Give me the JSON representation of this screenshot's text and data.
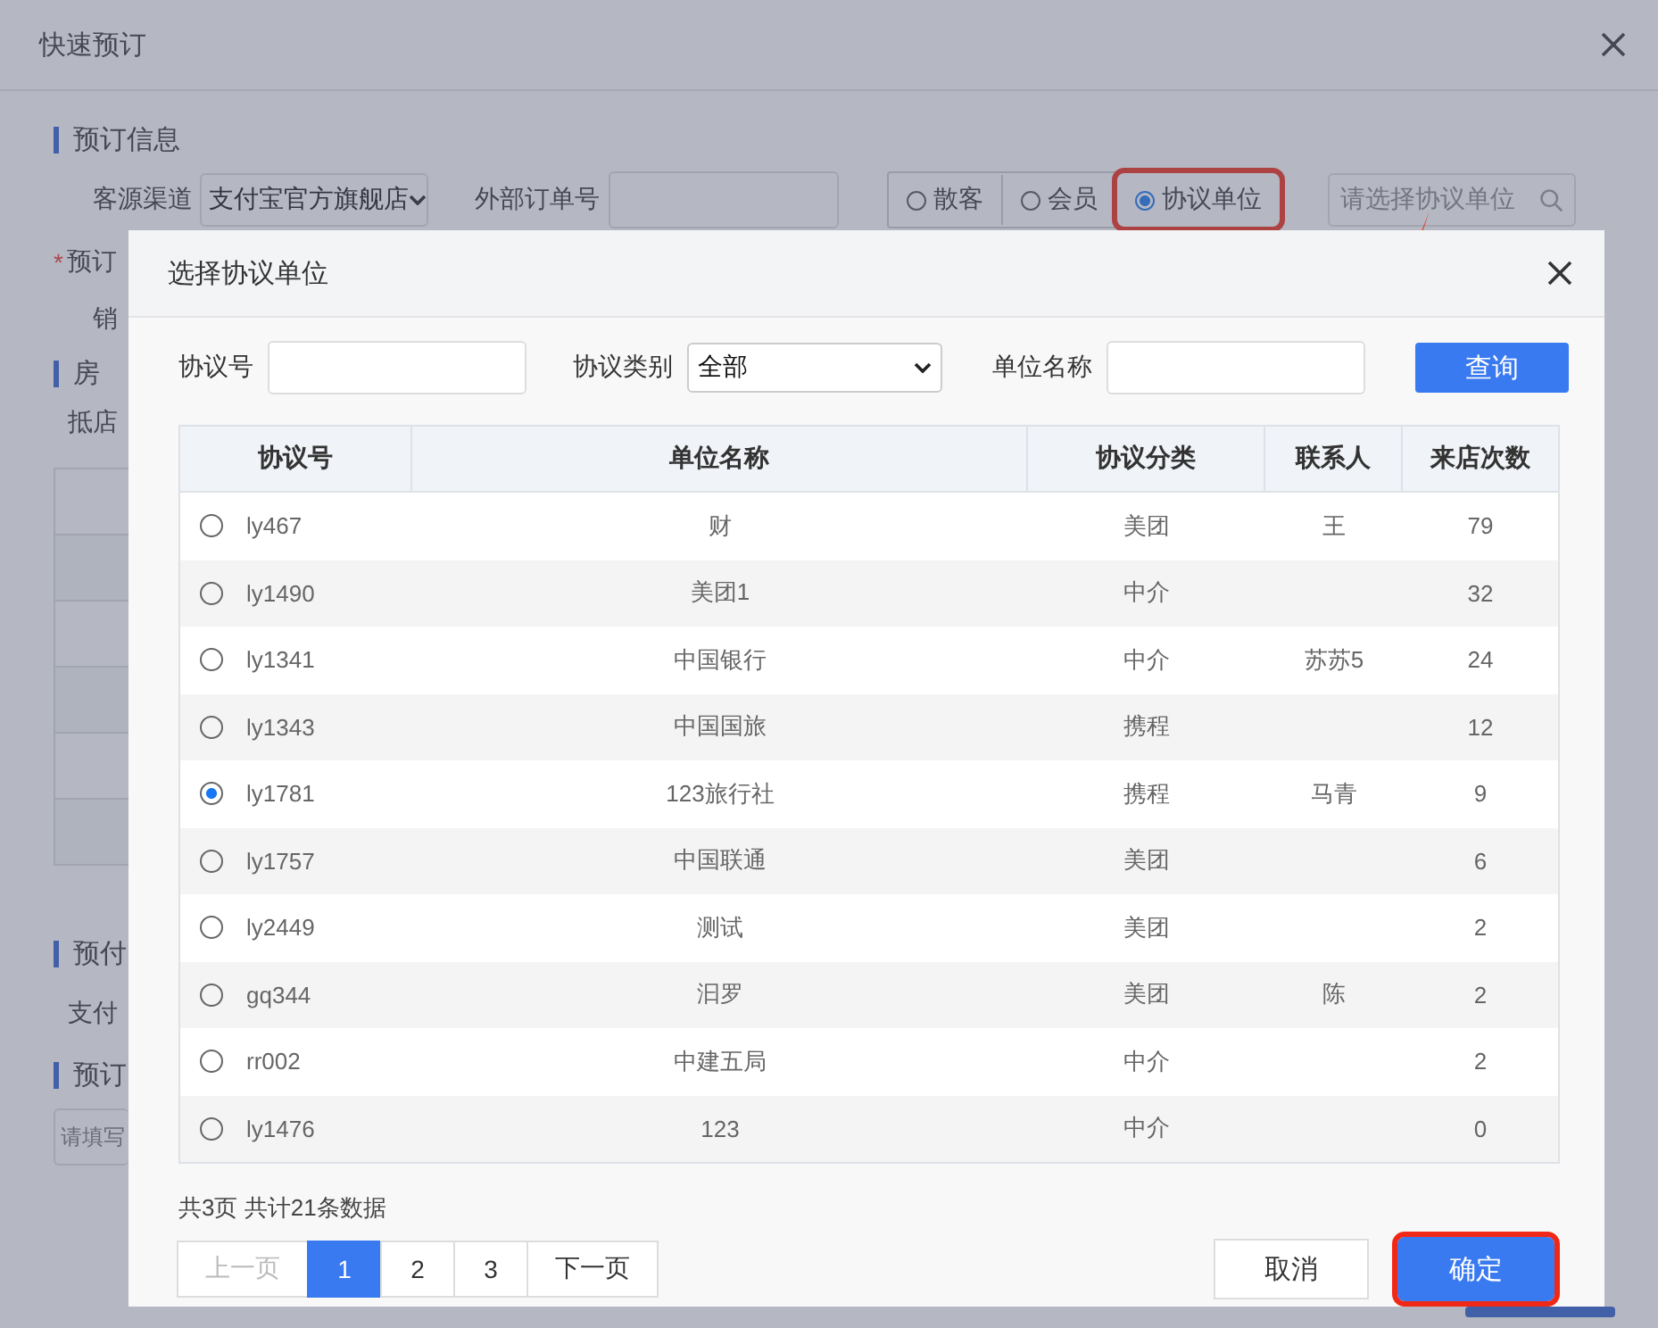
{
  "background_dialog": {
    "title": "快速预订",
    "section_1": {
      "title": "预订信息",
      "channel_label": "客源渠道",
      "channel_value": "支付宝官方旗舰店",
      "external_label": "外部订单号",
      "guest_types": [
        {
          "label": "散客",
          "selected": false,
          "highlighted": false
        },
        {
          "label": "会员",
          "selected": false,
          "highlighted": false
        },
        {
          "label": "协议单位",
          "selected": true,
          "highlighted": true
        }
      ],
      "unit_placeholder": "请选择协议单位",
      "booker_required": "*",
      "booker_label": "预订",
      "sales_label": "销"
    },
    "section_2": {
      "title": "房",
      "arrival_label": "抵店"
    },
    "section_3": {
      "title": "预付",
      "payment_label": "支付"
    },
    "section_4": {
      "title": "预订",
      "remark_placeholder": "请填写"
    }
  },
  "modal": {
    "title": "选择协议单位",
    "filters": {
      "code_label": "协议号",
      "type_label": "协议类别",
      "type_value": "全部",
      "name_label": "单位名称",
      "search_button": "查询"
    },
    "table": {
      "columns": [
        "协议号",
        "单位名称",
        "协议分类",
        "联系人",
        "来店次数"
      ],
      "rows": [
        {
          "selected": false,
          "code": "ly467",
          "name": "财",
          "category": "美团",
          "contact": "王",
          "visits": "79"
        },
        {
          "selected": false,
          "code": "ly1490",
          "name": "美团1",
          "category": "中介",
          "visits": "32"
        },
        {
          "selected": false,
          "code": "ly1341",
          "name": "中国银行",
          "category": "中介",
          "contact": "苏苏5",
          "visits": "24"
        },
        {
          "selected": false,
          "code": "ly1343",
          "name": "中国国旅",
          "category": "携程",
          "visits": "12"
        },
        {
          "selected": true,
          "code": "ly1781",
          "name": "123旅行社",
          "category": "携程",
          "contact": "马青",
          "visits": "9"
        },
        {
          "selected": false,
          "code": "ly1757",
          "name": "中国联通",
          "category": "美团",
          "visits": "6"
        },
        {
          "selected": false,
          "code": "ly2449",
          "name": "测试",
          "category": "美团",
          "visits": "2"
        },
        {
          "selected": false,
          "code": "gq344",
          "name": "汩罗",
          "category": "美团",
          "contact": "陈",
          "visits": "2"
        },
        {
          "selected": false,
          "code": "rr002",
          "name": "中建五局",
          "category": "中介",
          "visits": "2"
        },
        {
          "selected": false,
          "code": "ly1476",
          "name": "123",
          "category": "中介",
          "visits": "0"
        }
      ]
    },
    "summary": "共3页 共计21条数据",
    "pagination": {
      "prev": {
        "label": "上一页",
        "disabled": true
      },
      "pages": [
        {
          "label": "1",
          "selected": true
        },
        {
          "label": "2",
          "selected": false
        },
        {
          "label": "3",
          "selected": false
        }
      ],
      "next": {
        "label": "下一页",
        "disabled": false
      }
    },
    "cancel_button": "取消",
    "confirm_button": {
      "label": "确定",
      "highlighted": true
    }
  }
}
